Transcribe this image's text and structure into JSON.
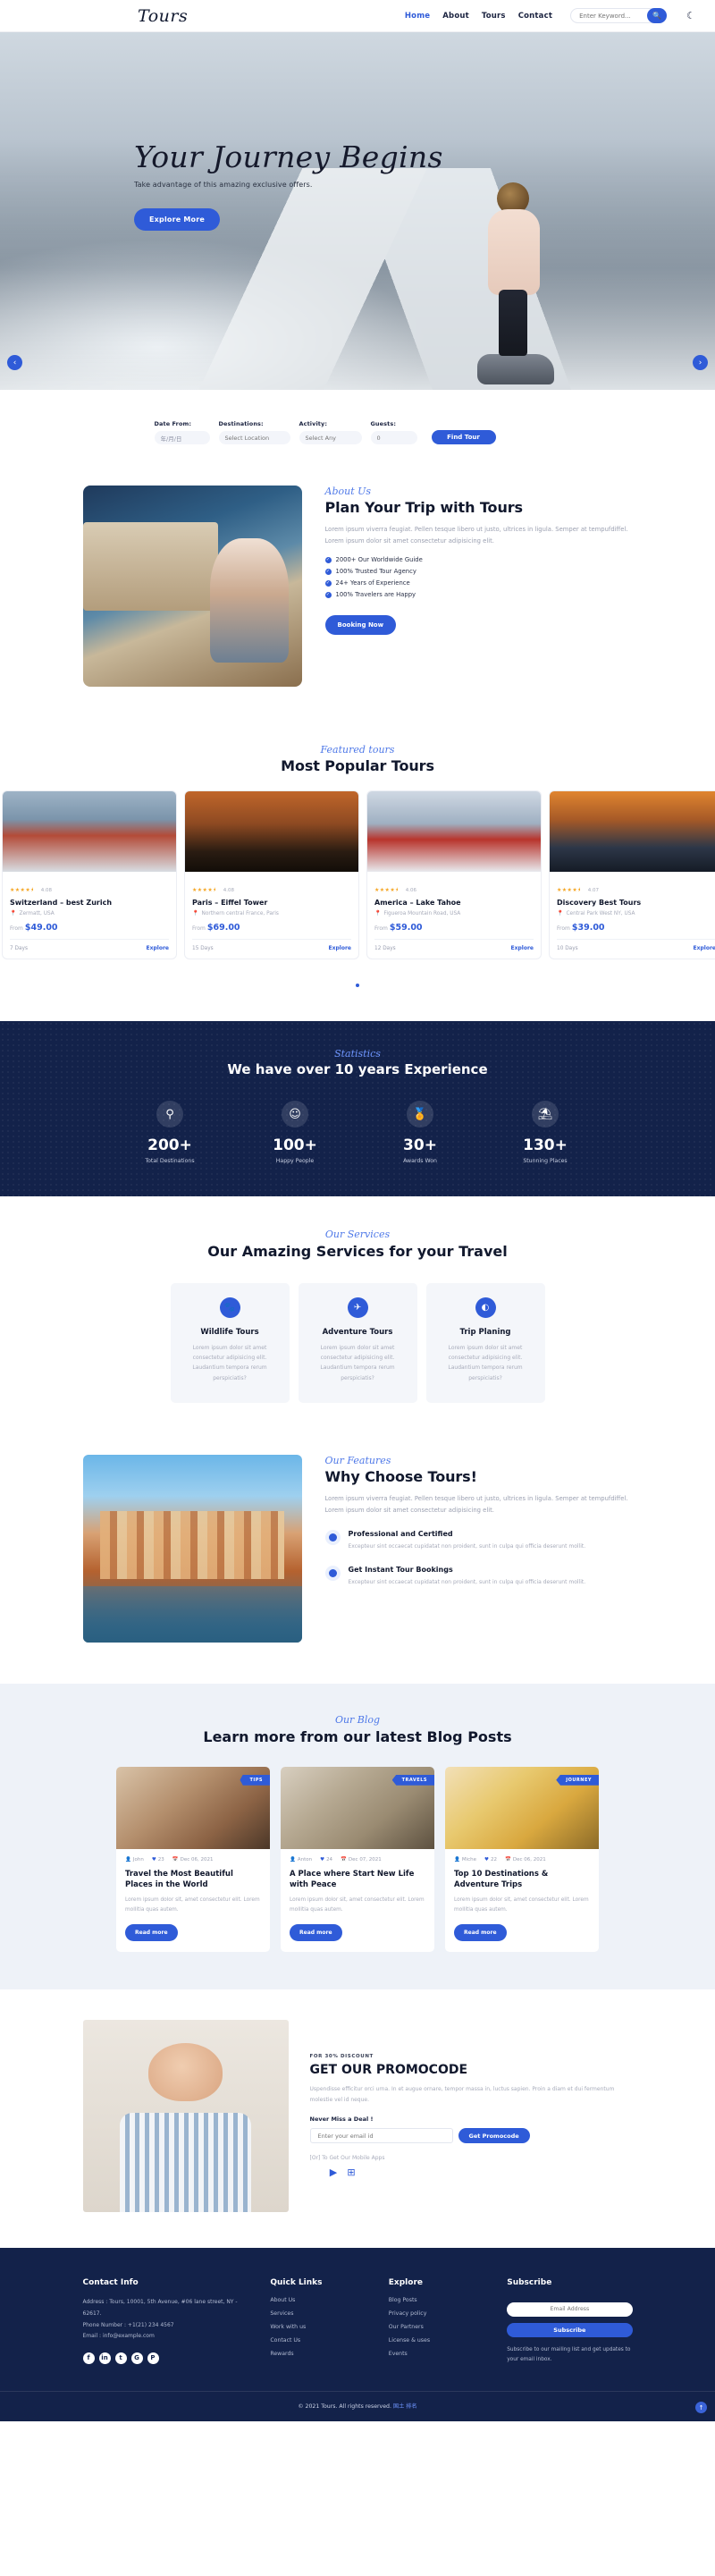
{
  "header": {
    "brand": "Tours",
    "nav": [
      {
        "label": "Home",
        "active": true
      },
      {
        "label": "About",
        "active": false
      },
      {
        "label": "Tours",
        "active": false
      },
      {
        "label": "Contact",
        "active": false
      }
    ],
    "search_placeholder": "Enter Keyword...",
    "search_icon": "search-icon",
    "theme_icon": "moon-icon"
  },
  "hero": {
    "title": "Your Journey Begins",
    "subtitle": "Take advantage of this amazing exclusive offers.",
    "cta": "Explore More",
    "prev_icon": "chevron-left-icon",
    "next_icon": "chevron-right-icon"
  },
  "search_form": {
    "fields": [
      {
        "label": "Date From:",
        "value": "年/月/日"
      },
      {
        "label": "Destinations:",
        "value": "Select Location"
      },
      {
        "label": "Activity:",
        "value": "Select Any"
      },
      {
        "label": "Guests:",
        "value": "0"
      }
    ],
    "submit": "Find Tour"
  },
  "about": {
    "eyebrow": "About Us",
    "title": "Plan Your Trip with Tours",
    "text": "Lorem ipsum viverra feugiat. Pellen tesque libero ut justo, ultrices in ligula. Semper at tempufdiffel. Lorem ipsum dolor sit amet consectetur adipisicing elit.",
    "checks": [
      "2000+ Our Worldwide Guide",
      "100% Trusted Tour Agency",
      "24+ Years of Experience",
      "100% Travelers are Happy"
    ],
    "cta": "Booking Now"
  },
  "popular": {
    "eyebrow": "Featured tours",
    "title": "Most Popular Tours",
    "price_prefix": "From",
    "explore_label": "Explore",
    "tours": [
      {
        "stars": "★★★★⯨",
        "rating": "4.08",
        "title": "Switzerland – best Zurich",
        "location": "Zermatt, USA",
        "price": "$49.00",
        "days": "7 Days"
      },
      {
        "stars": "★★★★⯨",
        "rating": "4.08",
        "title": "Paris – Eiffel Tower",
        "location": "Northern central France, Paris",
        "price": "$69.00",
        "days": "15 Days"
      },
      {
        "stars": "★★★★⯨",
        "rating": "4.06",
        "title": "America – Lake Tahoe",
        "location": "Figueroa Mountain Road, USA",
        "price": "$59.00",
        "days": "12 Days"
      },
      {
        "stars": "★★★★⯨",
        "rating": "4.07",
        "title": "Discovery Best Tours",
        "location": "Central Park West NY, USA",
        "price": "$39.00",
        "days": "10 Days"
      }
    ]
  },
  "stats": {
    "eyebrow": "Statistics",
    "title": "We have over 10 years Experience",
    "items": [
      {
        "icon": "route-icon",
        "glyph": "⚲",
        "value": "200+",
        "label": "Total Destinations"
      },
      {
        "icon": "smile-icon",
        "glyph": "☺",
        "value": "100+",
        "label": "Happy People"
      },
      {
        "icon": "medal-icon",
        "glyph": "🏅",
        "value": "30+",
        "label": "Awards Won"
      },
      {
        "icon": "beach-icon",
        "glyph": "⛱",
        "value": "130+",
        "label": "Stunning Places"
      }
    ]
  },
  "services": {
    "eyebrow": "Our Services",
    "title": "Our Amazing Services for your Travel",
    "cards": [
      {
        "icon": "wildlife-icon",
        "glyph": "🐾",
        "name": "Wildlife Tours",
        "text": "Lorem ipsum dolor sit amet consectetur adipisicing elit. Laudantium tempora rerum perspiciatis?"
      },
      {
        "icon": "adventure-icon",
        "glyph": "✈",
        "name": "Adventure Tours",
        "text": "Lorem ipsum dolor sit amet consectetur adipisicing elit. Laudantium tempora rerum perspiciatis?"
      },
      {
        "icon": "planning-icon",
        "glyph": "◐",
        "name": "Trip Planing",
        "text": "Lorem ipsum dolor sit amet consectetur adipisicing elit. Laudantium tempora rerum perspiciatis?"
      }
    ]
  },
  "why": {
    "eyebrow": "Our Features",
    "title": "Why Choose Tours!",
    "text": "Lorem ipsum viverra feugiat. Pellen tesque libero ut justo, ultrices in ligula. Semper at tempufdiffel. Lorem ipsum dolor sit amet consectetur adipisicing elit.",
    "features": [
      {
        "title": "Professional and Certified",
        "text": "Excepteur sint occaecat cupidatat non proident, sunt in culpa qui officia deserunt mollit."
      },
      {
        "title": "Get Instant Tour Bookings",
        "text": "Excepteur sint occaecat cupidatat non proident, sunt in culpa qui officia deserunt mollit."
      }
    ]
  },
  "blog": {
    "eyebrow": "Our Blog",
    "title": "Learn more from our latest Blog Posts",
    "read_label": "Read more",
    "posts": [
      {
        "badge": "TIPS",
        "author": "John",
        "likes": "23",
        "date": "Dec 06, 2021",
        "title": "Travel the Most Beautiful Places in the World",
        "text": "Lorem ipsum dolor sit, amet consectetur elit. Lorem mollitia quas autem."
      },
      {
        "badge": "TRAVELS",
        "author": "Anton",
        "likes": "24",
        "date": "Dec 07, 2021",
        "title": "A Place where Start New Life with Peace",
        "text": "Lorem ipsum dolor sit, amet consectetur elit. Lorem mollitia quas autem."
      },
      {
        "badge": "JOURNEY",
        "author": "Miche",
        "likes": "22",
        "date": "Dec 06, 2021",
        "title": "Top 10 Destinations & Adventure Trips",
        "text": "Lorem ipsum dolor sit, amet consectetur elit. Lorem mollitia quas autem."
      }
    ]
  },
  "promo": {
    "kicker": "FOR 30% DISCOUNT",
    "title": "GET OUR PROMOCODE",
    "text": "Uspendisse efficitur orci urna. In et augue ornare, tempor massa in, luctus sapien. Proin a diam et dui fermentum molestie vel id neque.",
    "deal_label": "Never Miss a Deal !",
    "email_placeholder": "Enter your email id",
    "cta": "Get Promocode",
    "apps_label": "[Or] To Get Our Mobile Apps",
    "apps": [
      {
        "icon": "apple-store-icon",
        "glyph": ""
      },
      {
        "icon": "google-play-icon",
        "glyph": "▶"
      },
      {
        "icon": "windows-store-icon",
        "glyph": "⊞"
      }
    ]
  },
  "footer": {
    "contact": {
      "title": "Contact Info",
      "address": "Address : Tours, 10001, 5th Avenue, #06 lane street, NY - 62617.",
      "phone": "Phone Number : +1(21) 234 4567",
      "email": "Email : info@example.com",
      "socials": [
        {
          "icon": "facebook-icon",
          "glyph": "f"
        },
        {
          "icon": "linkedin-icon",
          "glyph": "in"
        },
        {
          "icon": "twitter-icon",
          "glyph": "t"
        },
        {
          "icon": "google-plus-icon",
          "glyph": "G"
        },
        {
          "icon": "pinterest-icon",
          "glyph": "P"
        }
      ]
    },
    "quick_links": {
      "title": "Quick Links",
      "items": [
        "About Us",
        "Services",
        "Work with us",
        "Contact Us",
        "Rewards"
      ]
    },
    "explore": {
      "title": "Explore",
      "items": [
        "Blog Posts",
        "Privacy policy",
        "Our Partners",
        "License & uses",
        "Events"
      ]
    },
    "subscribe": {
      "title": "Subscribe",
      "placeholder": "Email Address",
      "cta": "Subscribe",
      "note": "Subscribe to our mailing list and get updates to your email inbox."
    },
    "copyright": "© 2021 Tours. All rights reserved.",
    "copyright_link": "国土 排名"
  }
}
